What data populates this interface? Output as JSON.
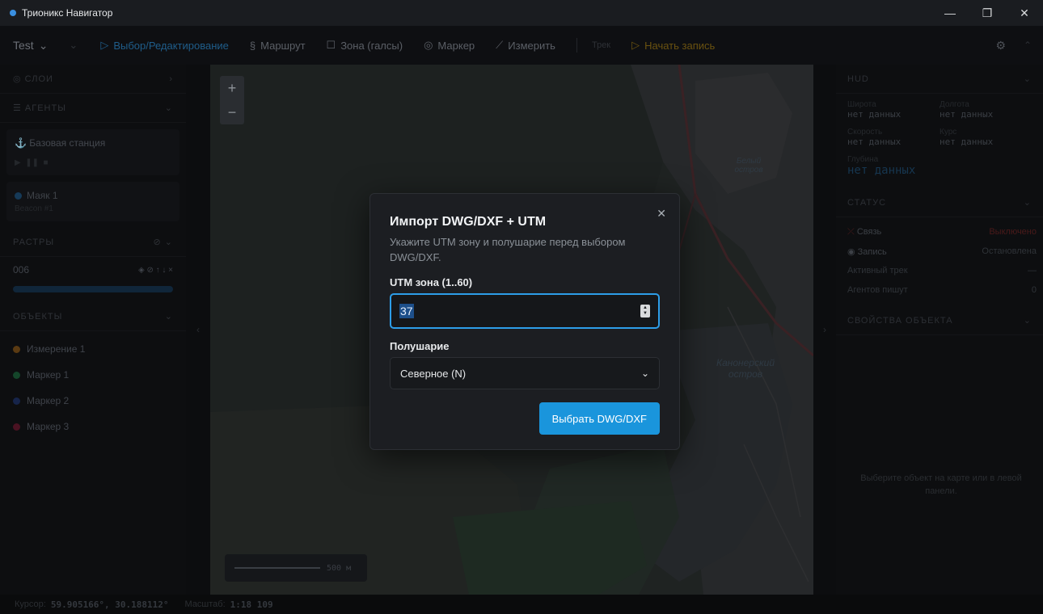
{
  "window": {
    "title": "Трионикс Навигатор",
    "controls": [
      "—",
      "❐",
      "✕"
    ]
  },
  "toolbar": {
    "project": "Test",
    "modes": [
      {
        "label": "Выбор/Редактирование",
        "icon": "cursor-icon",
        "active": true
      },
      {
        "label": "Маршрут",
        "icon": "route-icon"
      },
      {
        "label": "Зона (галсы)",
        "icon": "square-icon"
      },
      {
        "label": "Маркер",
        "icon": "pin-icon"
      },
      {
        "label": "Измерить",
        "icon": "ruler-icon"
      }
    ],
    "track_label": "Трек",
    "record_label": "Начать запись"
  },
  "left_panel": {
    "layers_header": "СЛОИ",
    "agents_header": "АГЕНТЫ",
    "base_station": "Базовая станция",
    "beacon_name": "Маяк 1",
    "beacon_id": "Beacon #1",
    "rasters_header": "РАСТРЫ",
    "raster_name": "006",
    "objects_header": "ОБЪЕКТЫ",
    "objects": [
      {
        "label": "Измерение 1",
        "color": "#5a3a12"
      },
      {
        "label": "Маркер 1",
        "color": "#14452a"
      },
      {
        "label": "Маркер 2",
        "color": "#16244a"
      },
      {
        "label": "Маркер 3",
        "color": "#4a1222"
      }
    ]
  },
  "map": {
    "labels": [
      "Белый остров",
      "Канонерский остров"
    ],
    "scale_text": "500 м"
  },
  "right_panel": {
    "hud_header": "HUD",
    "hud": [
      {
        "label": "Широта",
        "value": "нет данных"
      },
      {
        "label": "Долгота",
        "value": "нет данных"
      },
      {
        "label": "Скорость",
        "value": "нет данных"
      },
      {
        "label": "Курс",
        "value": "нет данных"
      }
    ],
    "depth_label": "Глубина",
    "depth_value": "нет данных",
    "status_header": "СТАТУС",
    "status": [
      {
        "label": "Связь",
        "value": "Выключено"
      },
      {
        "label": "Запись",
        "value": "Остановлена"
      },
      {
        "label": "Активный трек",
        "value": "—"
      },
      {
        "label": "Агентов пишут",
        "value": "0"
      }
    ],
    "props_header": "СВОЙСТВА ОБЪЕКТА",
    "props_hint": "Выберите объект на карте или в левой панели."
  },
  "statusbar": {
    "cursor_label": "Курсор:",
    "cursor_value": "59.905166°, 30.188112°",
    "scale_label": "Масштаб:",
    "scale_value": "1:18 109"
  },
  "dialog": {
    "title": "Импорт DWG/DXF + UTM",
    "subtitle": "Укажите UTM зону и полушарие перед выбором DWG/DXF.",
    "zone_label": "UTM зона (1..60)",
    "zone_value": "37",
    "hemisphere_label": "Полушарие",
    "hemisphere_value": "Северное (N)",
    "submit_label": "Выбрать DWG/DXF",
    "close_glyph": "✕"
  }
}
